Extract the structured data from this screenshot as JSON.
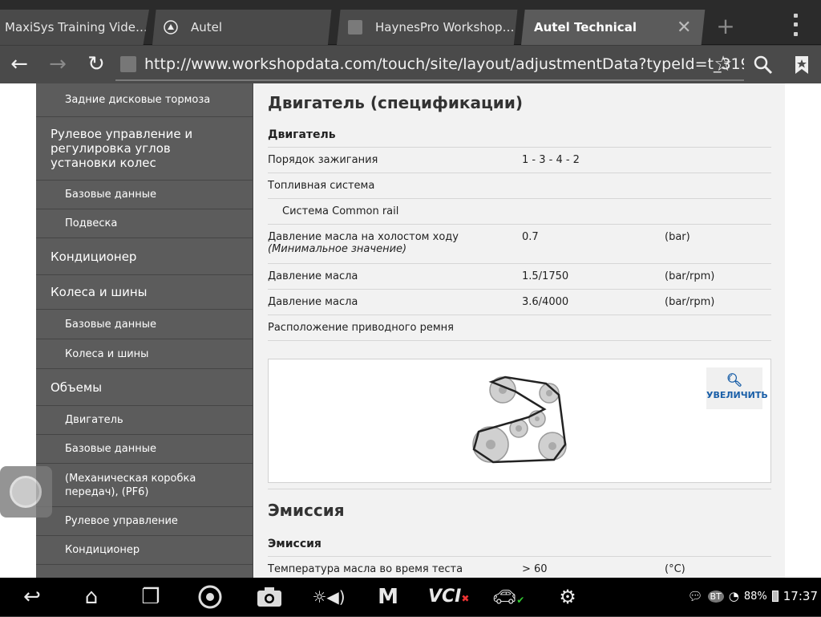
{
  "tabs": [
    {
      "label": "MaxiSys Training Vide…",
      "icon": ""
    },
    {
      "label": "Autel",
      "icon": "autel-logo-icon"
    },
    {
      "label": "HaynesPro Workshop…",
      "icon": "page-icon"
    },
    {
      "label": "Autel Technical",
      "icon": ""
    }
  ],
  "address_bar": {
    "url": "http://www.workshopdata.com/touch/site/layout/adjustmentData?typeId=t_319"
  },
  "sidebar": {
    "items": [
      {
        "label": "Задние дисковые тормоза",
        "level": 2
      },
      {
        "label": "Рулевое управление и регулировка углов установки колес",
        "level": 1
      },
      {
        "label": "Базовые данные",
        "level": 2
      },
      {
        "label": "Подвеска",
        "level": 2
      },
      {
        "label": "Кондиционер",
        "level": 1
      },
      {
        "label": "Колеса и шины",
        "level": 1
      },
      {
        "label": "Базовые данные",
        "level": 2
      },
      {
        "label": "Колеса и шины",
        "level": 2
      },
      {
        "label": "Объемы",
        "level": 1
      },
      {
        "label": "Двигатель",
        "level": 2
      },
      {
        "label": "Базовые данные",
        "level": 2
      },
      {
        "label": "(Механическая коробка передач), (PF6)",
        "level": 2
      },
      {
        "label": "Рулевое управление",
        "level": 2
      },
      {
        "label": "Кондиционер",
        "level": 2
      }
    ]
  },
  "engine_section": {
    "title": "Двигатель (спецификации)",
    "subhead": "Двигатель",
    "rows": [
      {
        "label": "Порядок зажигания",
        "note": "",
        "value": "1 - 3 - 4 - 2",
        "unit": ""
      },
      {
        "label": "Топливная система",
        "note": "",
        "value": "",
        "unit": ""
      },
      {
        "label": "Система Common rail",
        "note": "",
        "value": "",
        "unit": "",
        "indent": true
      },
      {
        "label": "Давление масла на холостом ходу",
        "note": "(Минимальное значение)",
        "value": "0.7",
        "unit": "(bar)"
      },
      {
        "label": "Давление масла",
        "note": "",
        "value": "1.5/1750",
        "unit": "(bar/rpm)"
      },
      {
        "label": "Давление масла",
        "note": "",
        "value": "3.6/4000",
        "unit": "(bar/rpm)"
      },
      {
        "label": "Расположение приводного ремня",
        "note": "",
        "value": "",
        "unit": ""
      }
    ],
    "zoom_label": "УВЕЛИЧИТЬ"
  },
  "emission_section": {
    "title": "Эмиссия",
    "subhead": "Эмиссия",
    "rows": [
      {
        "label": "Температура масла во время теста",
        "value": "> 60",
        "unit": "(°C)"
      }
    ]
  },
  "status_bar": {
    "battery": "88%",
    "time": "17:37"
  }
}
